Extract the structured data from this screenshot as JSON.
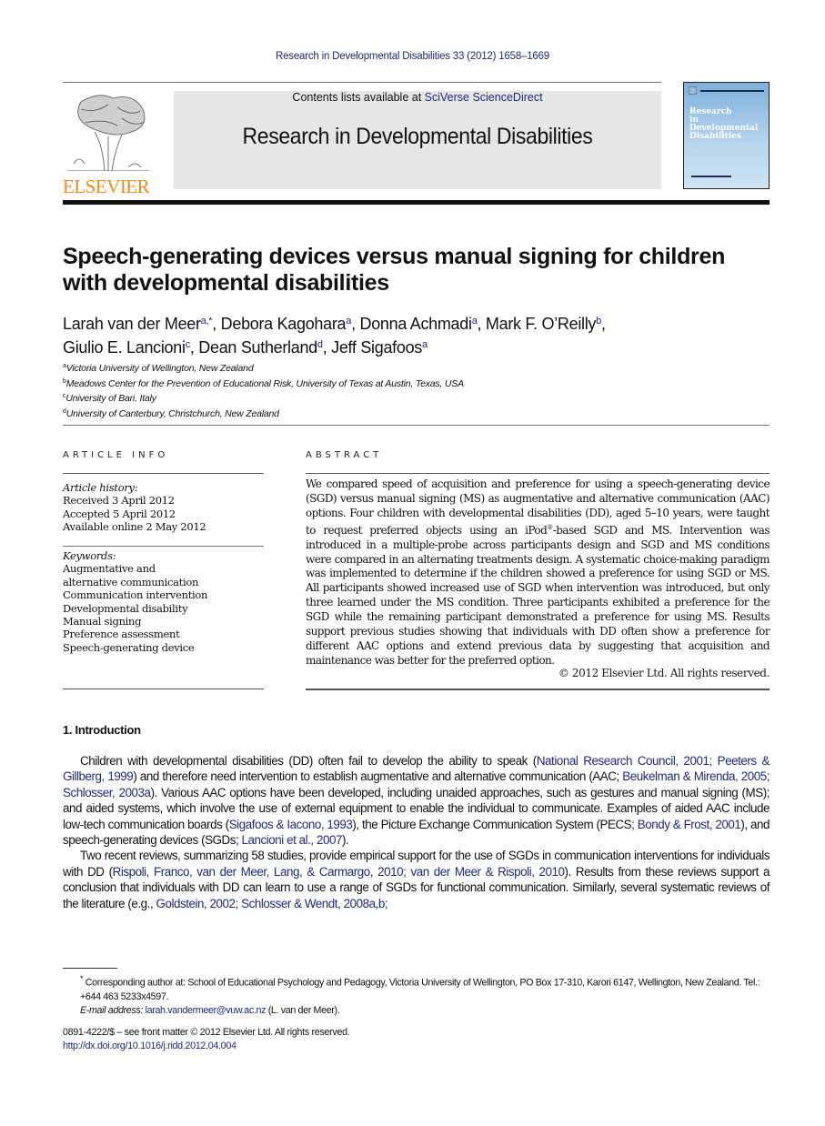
{
  "header": {
    "journal_reference": "Research in Developmental Disabilities 33 (2012) 1658–1669",
    "publisher_logo_text": "ELSEVIER",
    "contents_prefix": "Contents lists available at ",
    "contents_link": "SciVerse ScienceDirect",
    "journal_title": "Research in Developmental Disabilities",
    "cover_title_lines": [
      "Research",
      "in",
      "Developmental",
      "Disabilities"
    ],
    "colors": {
      "link": "#1f2a7a",
      "elsevier_orange": "#f28a1e",
      "masthead_bg": "#e6e6e6"
    }
  },
  "article": {
    "title": "Speech-generating devices versus manual signing for children with developmental disabilities",
    "authors_line1": [
      {
        "name": "Larah van der Meer",
        "sup": "a,*",
        "sep": ", "
      },
      {
        "name": "Debora Kagohara",
        "sup": "a",
        "sep": ", "
      },
      {
        "name": "Donna Achmadi",
        "sup": "a",
        "sep": ", "
      },
      {
        "name": "Mark F. O’Reilly",
        "sup": "b",
        "sep": ","
      }
    ],
    "authors_line2": [
      {
        "name": "Giulio E. Lancioni",
        "sup": "c",
        "sep": ", "
      },
      {
        "name": "Dean Sutherland",
        "sup": "d",
        "sep": ", "
      },
      {
        "name": "Jeff Sigafoos",
        "sup": "a",
        "sep": ""
      }
    ],
    "affiliations": [
      {
        "key": "a",
        "text": "Victoria University of Wellington, New Zealand"
      },
      {
        "key": "b",
        "text": "Meadows Center for the Prevention of Educational Risk, University of Texas at Austin, Texas, USA"
      },
      {
        "key": "c",
        "text": "University of Bari, Italy"
      },
      {
        "key": "d",
        "text": "University of Canterbury, Christchurch, New Zealand"
      }
    ]
  },
  "article_info": {
    "heading": "ARTICLE INFO",
    "history_label": "Article history:",
    "history": [
      "Received 3 April 2012",
      "Accepted 5 April 2012",
      "Available online 2 May 2012"
    ],
    "keywords_label": "Keywords:",
    "keywords": [
      "Augmentative and alternative communication",
      "Communication intervention",
      "Developmental disability",
      "Manual signing",
      "Preference assessment",
      "Speech-generating device"
    ]
  },
  "abstract": {
    "heading": "ABSTRACT",
    "text_before_sup": "We compared speed of acquisition and preference for using a speech-generating device (SGD) versus manual signing (MS) as augmentative and alternative communication (AAC) options. Four children with developmental disabilities (DD), aged 5–10 years, were taught to request preferred objects using an iPod",
    "sup": "®",
    "text_after_sup": "-based SGD and MS. Intervention was introduced in a multiple-probe across participants design and SGD and MS conditions were compared in an alternating treatments design. A systematic choice-making paradigm was implemented to determine if the children showed a preference for using SGD or MS. All participants showed increased use of SGD when intervention was introduced, but only three learned under the MS condition. Three participants exhibited a preference for the SGD while the remaining participant demonstrated a preference for using MS. Results support previous studies showing that individuals with DD often show a preference for different AAC options and extend previous data by suggesting that acquisition and maintenance was better for the preferred option.",
    "copyright": "© 2012 Elsevier Ltd. All rights reserved."
  },
  "introduction": {
    "heading": "1. Introduction",
    "paragraphs": [
      [
        {
          "t": "Children with developmental disabilities (DD) often fail to develop the ability to speak ("
        },
        {
          "link": "National Research Council, 2001; Peeters & Gillberg, 1999"
        },
        {
          "t": ") and therefore need intervention to establish augmentative and alternative communication (AAC; "
        },
        {
          "link": "Beukelman & Mirenda, 2005; Schlosser, 2003a"
        },
        {
          "t": "). Various AAC options have been developed, including unaided approaches, such as gestures and manual signing (MS); and aided systems, which involve the use of external equipment to enable the individual to communicate. Examples of aided AAC include low-tech communication boards ("
        },
        {
          "link": "Sigafoos & Iacono, 1993"
        },
        {
          "t": "), the Picture Exchange Communication System (PECS; "
        },
        {
          "link": "Bondy & Frost, 2001"
        },
        {
          "t": "), and speech-generating devices (SGDs; "
        },
        {
          "link": "Lancioni et al., 2007"
        },
        {
          "t": ")."
        }
      ],
      [
        {
          "t": "Two recent reviews, summarizing 58 studies, provide empirical support for the use of SGDs in communication interventions for individuals with DD ("
        },
        {
          "link": "Rispoli, Franco, van der Meer, Lang, & Carmargo, 2010; van der Meer & Rispoli, 2010"
        },
        {
          "t": "). Results from these reviews support a conclusion that individuals with DD can learn to use a range of SGDs for functional communication. Similarly, several systematic reviews of the literature (e.g., "
        },
        {
          "link": "Goldstein, 2002; Schlosser & Wendt, 2008a,b;"
        }
      ]
    ]
  },
  "footnote": {
    "marker": "*",
    "corresponding": "Corresponding author at: School of Educational Psychology and Pedagogy, Victoria University of Wellington, PO Box 17-310, Karori 6147, Wellington, New Zealand. Tel.: +644 463 5233x4597.",
    "email_label": "E-mail address:",
    "email": "larah.vandermeer@vuw.ac.nz",
    "email_suffix": " (L. van der Meer)."
  },
  "footer": {
    "issn_line": "0891-4222/$ – see front matter © 2012 Elsevier Ltd. All rights reserved.",
    "doi": "http://dx.doi.org/10.1016/j.ridd.2012.04.004"
  }
}
